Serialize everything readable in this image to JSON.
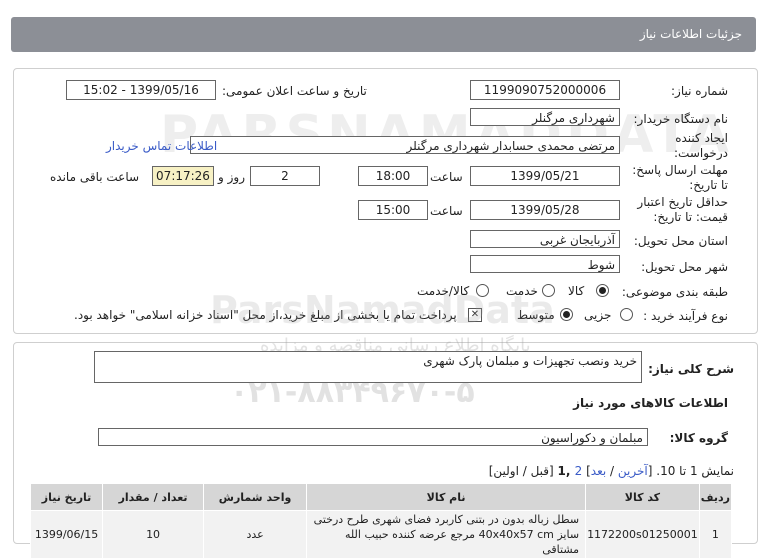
{
  "header": {
    "title": "جزئیات اطلاعات نیاز"
  },
  "form": {
    "need_number_label": "شماره نیاز:",
    "need_number": "1199090752000006",
    "announce_label": "تاریخ و ساعت اعلان عمومی:",
    "announce_value": "1399/05/16 - 15:02",
    "buyer_label": "نام دستگاه خریدار:",
    "buyer_value": "شهرداری مرگنلر",
    "creator_label_1": "ایجاد کننده",
    "creator_label_2": "درخواست:",
    "creator_value": "مرتضی محمدی حسابدار شهرداری مرگنلر",
    "contact_link": "اطلاعات تماس خریدار",
    "reply_label_1": "مهلت ارسال پاسخ:",
    "reply_label_2": "تا تاریخ:",
    "reply_date": "1399/05/21",
    "time_label": "ساعت",
    "reply_time": "18:00",
    "days_value": "2",
    "days_label": "روز و",
    "remaining_time": "07:17:26",
    "remaining_label": "ساعت باقی مانده",
    "validity_label_1": "حداقل تاریخ اعتبار",
    "validity_label_2": "قیمت: تا تاریخ:",
    "validity_date": "1399/05/28",
    "validity_time_label": "ساعت",
    "validity_time": "15:00",
    "province_label": "استان محل تحویل:",
    "province_value": "آذربایجان غربی",
    "city_label": "شهر محل تحویل:",
    "city_value": "شوط",
    "category_label": "طبقه بندی موضوعی:",
    "category_options": [
      "کالا",
      "خدمت",
      "کالا/خدمت"
    ],
    "purchase_label": "نوع فرآیند خرید :",
    "purchase_options": [
      "جزیی",
      "متوسط"
    ],
    "payment_note": "پرداخت تمام یا بخشی از مبلغ خرید،از محل \"اسناد خزانه اسلامی\" خواهد بود."
  },
  "summary": {
    "label": "شرح کلی نیاز:",
    "value": "خرید ونصب تجهیزات و مبلمان پارک شهری",
    "goods_title": "اطلاعات کالاهای مورد نیاز",
    "group_label": "گروه کالا:",
    "group_value": "مبلمان و دکوراسیون",
    "pager_prefix": "نمایش 1 تا 10. [",
    "pager_last": "آخرین",
    "pager_sep1": " / ",
    "pager_next": "بعد",
    "pager_mid": "] ",
    "pager_page2": "2",
    "pager_current": " ,1",
    "pager_suffix": " [قبل / اولین]"
  },
  "table": {
    "headers": [
      "ردیف",
      "کد کالا",
      "نام کالا",
      "واحد شمارش",
      "تعداد / مقدار",
      "تاریخ نیاز"
    ],
    "rows": [
      {
        "index": "1",
        "code": "1172200s01250001",
        "name_line1": "سطل زباله بدون در بتنی کاربرد فضای شهری طرح درختی",
        "name_line2": "سایز 40x40x57 cm مرجع عرضه کننده حبیب الله مشتاقی",
        "unit": "عدد",
        "qty": "10",
        "date": "1399/06/15"
      }
    ]
  },
  "watermark": {
    "line1": "PARSNAMADDATA",
    "line2": "ParsNamadData",
    "line3": "پایگاه اطلاع رسانی مناقصه و مزایده",
    "line4": "۰۲۱-۸۸۳۴۹۶۷۰-۵"
  }
}
